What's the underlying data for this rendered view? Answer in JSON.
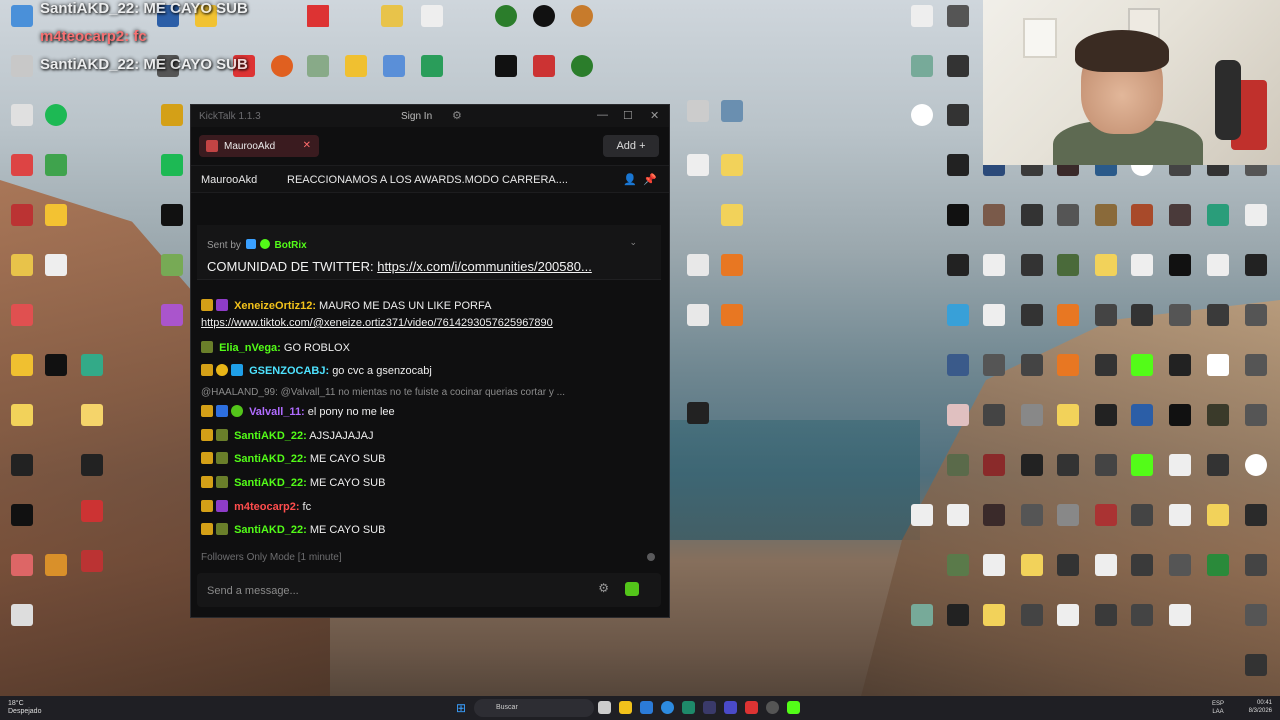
{
  "overlay": {
    "line1": "SantiAKD_22: ME CAYO SUB",
    "line2": "m4teocarp2: fc",
    "line3": "SantiAKD_22: ME CAYO SUB"
  },
  "app": {
    "title": "KickTalk 1.1.3",
    "sign_in": "Sign In",
    "settings_icon": "gear-icon",
    "tab_label": "MaurooAkd",
    "add_label": "Add",
    "add_icon": "plus-icon"
  },
  "channel": {
    "name": "MaurooAkd",
    "stream_title": "REACCIONAMOS A LOS AWARDS.MODO CARRERA...."
  },
  "pinned": {
    "sent_by_label": "Sent by",
    "author": "BotRix",
    "message_prefix": "COMUNIDAD DE TWITTER:",
    "message_link": "https://x.com/i/communities/200580..."
  },
  "messages": [
    {
      "user": "XeneizeOrtiz12:",
      "color": "#f2c21b",
      "text": "MAURO ME DAS UN LIKE PORFA"
    },
    {
      "link": "https://www.tiktok.com/@xeneize.ortiz371/video/7614293057625967890"
    },
    {
      "user": "Elia_nVega:",
      "color": "#53fc18",
      "text": "GO ROBLOX"
    },
    {
      "user": "GSENZOCABJ:",
      "color": "#4ee3ff",
      "text": "go cvc a gsenzocabj"
    },
    {
      "reply": "@HAALAND_99: @Valvall_11 no mientas no te fuiste a cocinar querias cortar y ..."
    },
    {
      "user": "Valvall_11:",
      "color": "#b06cff",
      "text": "el pony no me lee"
    },
    {
      "user": "SantiAKD_22:",
      "color": "#53fc18",
      "text": "AJSJAJAJAJ"
    },
    {
      "user": "SantiAKD_22:",
      "color": "#53fc18",
      "text": "ME CAYO SUB"
    },
    {
      "user": "SantiAKD_22:",
      "color": "#53fc18",
      "text": "ME CAYO SUB"
    },
    {
      "user": "m4teocarp2:",
      "color": "#ff4d4d",
      "text": "fc"
    },
    {
      "user": "SantiAKD_22:",
      "color": "#53fc18",
      "text": "ME CAYO SUB"
    }
  ],
  "footer": {
    "mode": "Followers Only Mode [1 minute]",
    "placeholder": "Send a message..."
  },
  "taskbar": {
    "weather_temp": "18°C",
    "weather_desc": "Despejado",
    "search": "Buscar",
    "lang": "ESP",
    "lang_sub": "LAA",
    "time": "00:41",
    "date": "8/3/2026"
  }
}
